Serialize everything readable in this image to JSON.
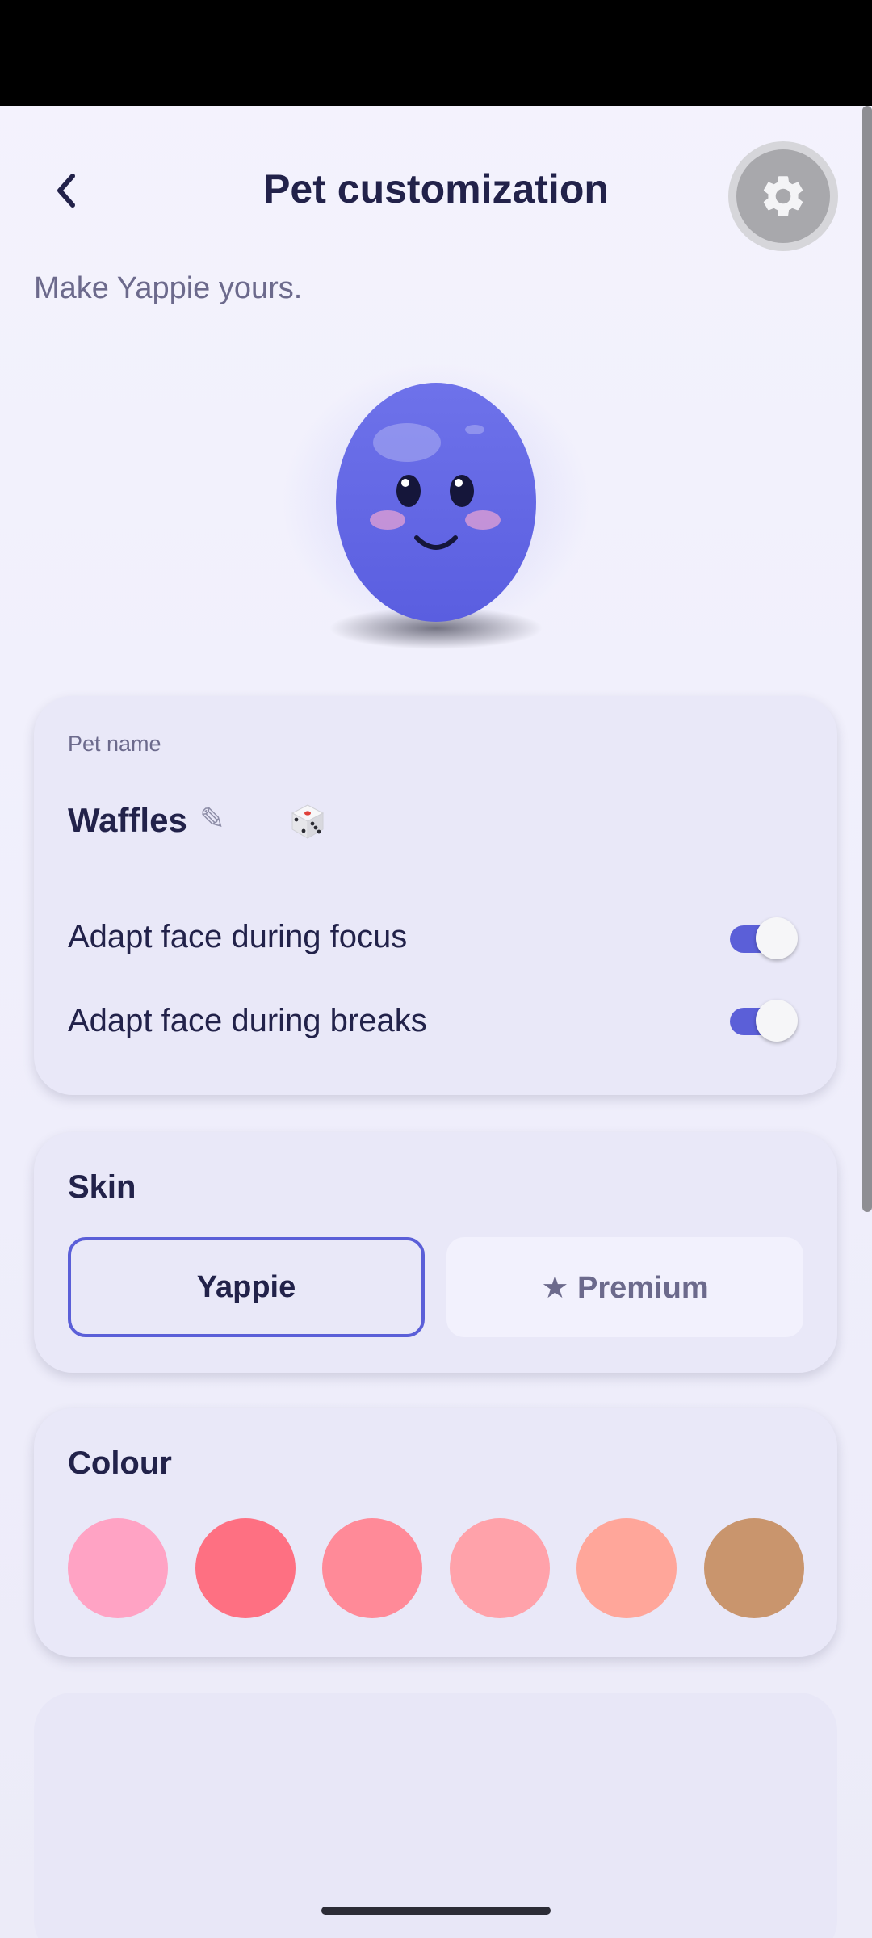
{
  "header": {
    "title": "Pet customization",
    "back_icon": "chevron-left-icon",
    "settings_icon": "gear-icon"
  },
  "subtitle": "Make Yappie yours.",
  "pet": {
    "body_color": "#6468e4",
    "cheek_color": "#d59ad6"
  },
  "name_card": {
    "label": "Pet name",
    "name": "Waffles",
    "edit_icon": "pencil-icon",
    "random_icon": "dice-icon",
    "toggles": [
      {
        "label": "Adapt face during focus",
        "on": true
      },
      {
        "label": "Adapt face during breaks",
        "on": true
      }
    ]
  },
  "skin_card": {
    "title": "Skin",
    "options": [
      {
        "label": "Yappie",
        "selected": true
      },
      {
        "label": "★ Premium",
        "selected": false
      }
    ]
  },
  "colour_card": {
    "title": "Colour",
    "swatches": [
      "#ffa3c4",
      "#fe7082",
      "#ff8a98",
      "#ffa2aa",
      "#ffa69a",
      "#c9956d"
    ]
  },
  "theme": {
    "accent": "#5b5fd8",
    "text_primary": "#22224a",
    "text_secondary": "#6c6a8c"
  }
}
